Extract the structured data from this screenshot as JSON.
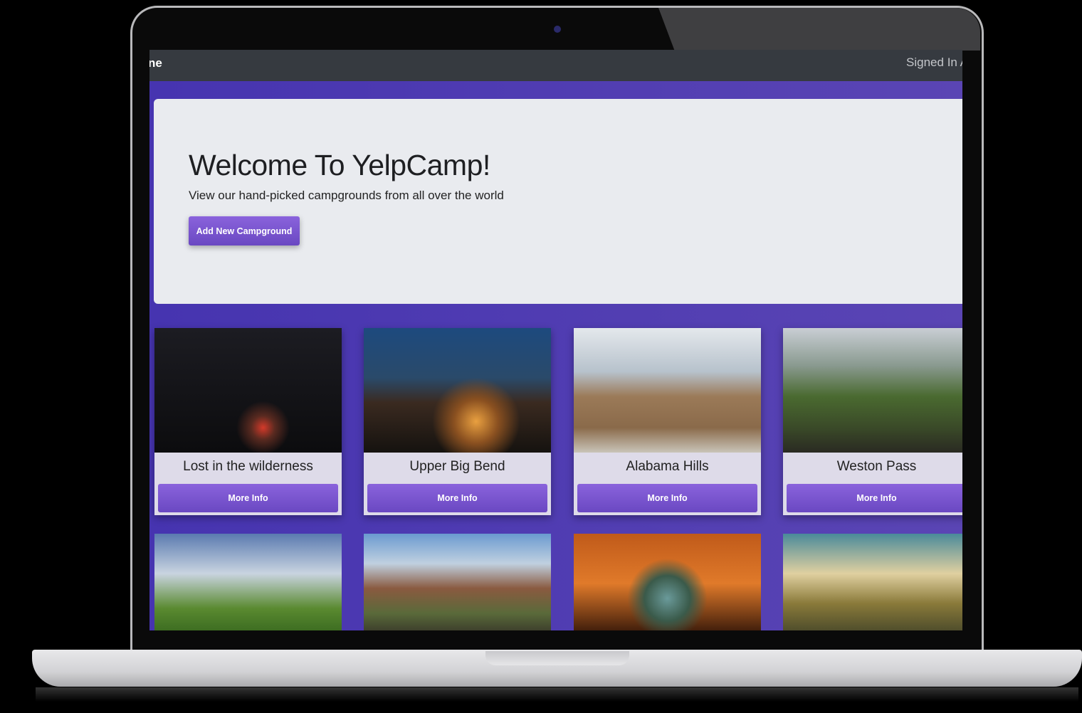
{
  "navbar": {
    "brand": "ne",
    "signed_in": "Signed In A"
  },
  "jumbotron": {
    "title": "Welcome To YelpCamp!",
    "subtitle": "View our hand-picked campgrounds from all over the world",
    "add_button": "Add New Campground"
  },
  "campgrounds": [
    {
      "name": "Lost in the wilderness",
      "button": "More Info"
    },
    {
      "name": "Upper Big Bend",
      "button": "More Info"
    },
    {
      "name": "Alabama Hills",
      "button": "More Info"
    },
    {
      "name": "Weston Pass",
      "button": "More Info"
    }
  ],
  "colors": {
    "navbar": "#363a40",
    "background": "#4e3cb2",
    "button": "#7a55d0",
    "jumbotron": "#e9ebef"
  }
}
